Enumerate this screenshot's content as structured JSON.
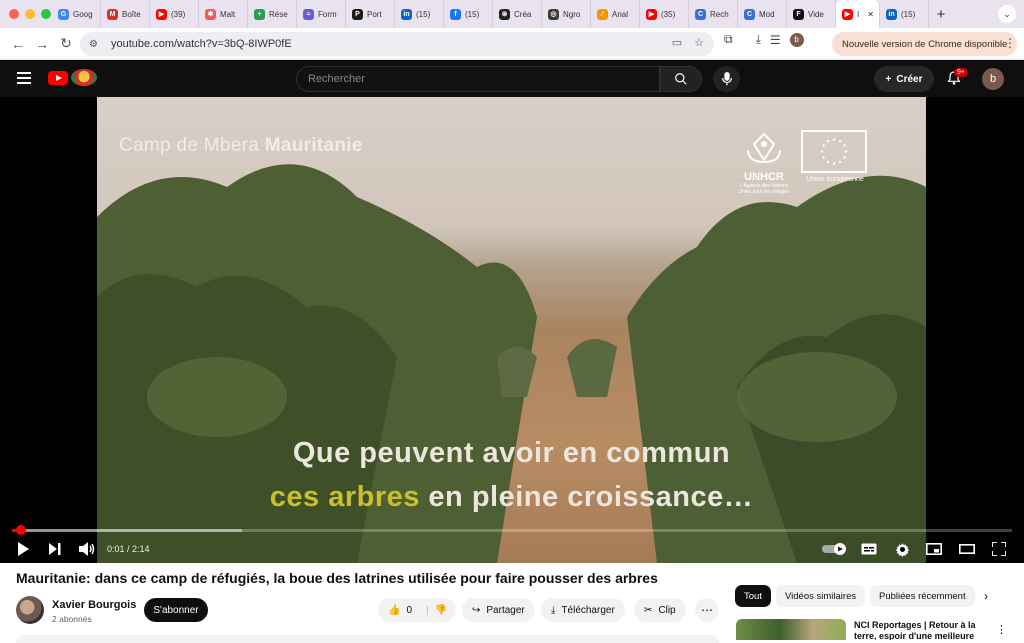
{
  "browser": {
    "tabs": [
      {
        "label": "Goog",
        "icon": "google-icon",
        "color": "#4285f4",
        "glyph": "G"
      },
      {
        "label": "Boîte",
        "icon": "gmail-icon",
        "color": "#d93025",
        "glyph": "M"
      },
      {
        "label": "(39)",
        "icon": "youtube-icon",
        "color": "#ff0000",
        "glyph": "▶"
      },
      {
        "label": "Malt",
        "icon": "malt-icon",
        "color": "#fc5757",
        "glyph": "✱"
      },
      {
        "label": "Rése",
        "icon": "reseau-icon",
        "color": "#2e9d4b",
        "glyph": "+"
      },
      {
        "label": "Form",
        "icon": "forms-icon",
        "color": "#6b5bd6",
        "glyph": "≈"
      },
      {
        "label": "Port",
        "icon": "port-icon",
        "color": "#1a1a1a",
        "glyph": "P"
      },
      {
        "label": "(15)",
        "icon": "linkedin-icon",
        "color": "#0a66c2",
        "glyph": "in"
      },
      {
        "label": "(15)",
        "icon": "facebook-icon",
        "color": "#1877f2",
        "glyph": "f"
      },
      {
        "label": "Créa",
        "icon": "openai-icon",
        "color": "#222222",
        "glyph": "⊛"
      },
      {
        "label": "Ngro",
        "icon": "ngrok-icon",
        "color": "#3a3a3a",
        "glyph": "◎"
      },
      {
        "label": "Anal",
        "icon": "analytics-icon",
        "color": "#f29900",
        "glyph": "⁄"
      },
      {
        "label": "(35)",
        "icon": "youtube-icon",
        "color": "#ff0000",
        "glyph": "▶"
      },
      {
        "label": "Rech",
        "icon": "search-tab-icon",
        "color": "#3b6fd8",
        "glyph": "C"
      },
      {
        "label": "Mod",
        "icon": "mod-icon",
        "color": "#3b6fd8",
        "glyph": "C"
      },
      {
        "label": "Vide",
        "icon": "video-tab-icon",
        "color": "#111111",
        "glyph": "F"
      },
      {
        "label": "I",
        "icon": "youtube-icon",
        "color": "#ff0000",
        "glyph": "▶",
        "active": true,
        "close": "✕"
      },
      {
        "label": "(15)",
        "icon": "linkedin-icon",
        "color": "#0a66c2",
        "glyph": "in"
      }
    ],
    "new_tab": "+",
    "url": "youtube.com/watch?v=3bQ-8IWP0fE",
    "update_button": "Nouvelle version de Chrome disponible",
    "profile_initial": "b"
  },
  "youtube": {
    "search_placeholder": "Rechercher",
    "create_label": "Créer",
    "notifications_badge": "9+",
    "avatar_initial": "b"
  },
  "video": {
    "overlay_location_light": "Camp de Mbera ",
    "overlay_location_bold": "Mauritanie",
    "unhcr_name": "UNHCR",
    "unhcr_sub": "L'Agence des Nations Unies pour les réfugiés",
    "eu_label": "Union européenne",
    "subtitle_line1": "Que peuvent avoir en commun",
    "subtitle_line2_highlight": "ces arbres",
    "subtitle_line2_rest": " en pleine croissance…",
    "time": "0:01 / 2:14",
    "progress_fraction": 0.009,
    "buffer_fraction": 0.23
  },
  "watch": {
    "title": "Mauritanie: dans ce camp de réfugiés, la boue des latrines utilisée pour faire pousser des arbres",
    "channel_name": "Xavier Bourgois",
    "channel_subs": "2 abonnés",
    "subscribe_label": "S'abonner",
    "like_count": "0",
    "share_label": "Partager",
    "download_label": "Télécharger",
    "clip_label": "Clip",
    "chips": [
      "Tout",
      "Vidéos similaires",
      "Publiées récemment"
    ],
    "reco_title": "NCI Reportages | Retour à la terre, espoir d'une meilleure vie"
  }
}
